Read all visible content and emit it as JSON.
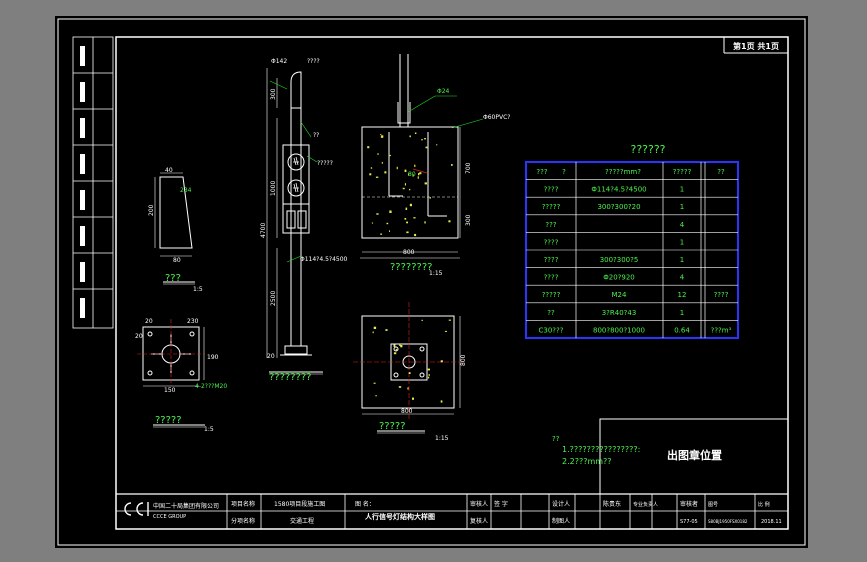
{
  "title_block": {
    "page_label": "第1页 共1页",
    "company_cn": "中国二十局集团有限公司",
    "company_en": "CCCE GROUP",
    "project_name_label": "项目名称",
    "project_name_value": "1580项目段施工图",
    "drawing_label": "图 名：",
    "drawing_value": "人行信号灯结构大样图",
    "sub_project_label": "分项名称",
    "sub_project_value": "交通工程",
    "reviewer_label": "审核人",
    "reviewer_value": "签 字",
    "checker_label": "复核人",
    "designer_label": "设计人",
    "designer_value": "陈贵东",
    "cad_label": "制图人",
    "spec_label": "专业负责人",
    "review_label": "审核者",
    "dwg_no_label": "图号",
    "dwg_no_value": "S80BJ1950FSX0182",
    "sheet_label": "比 例",
    "sheet_value": "S77-05",
    "date_value": "2018.11"
  },
  "stamp_label": "出图章位置",
  "notes": {
    "label": "??",
    "lines": [
      "1.????????????????:",
      "2.2???mm??"
    ]
  },
  "table": {
    "title": "??????",
    "headers": [
      "???",
      "?",
      "?????mm?",
      "?????",
      "??"
    ],
    "rows": [
      {
        "name": "????",
        "spec": "Φ114?4.5?4500",
        "qty": "1",
        "unit": ""
      },
      {
        "name": "?????",
        "spec": "300?300?20",
        "qty": "1",
        "unit": ""
      },
      {
        "name": "???",
        "spec": "",
        "qty": "4",
        "unit": ""
      },
      {
        "name": "????",
        "spec": "",
        "qty": "1",
        "unit": ""
      },
      {
        "name": "????",
        "spec": "300?300?5",
        "qty": "1",
        "unit": ""
      },
      {
        "name": "????",
        "spec": "Φ20?920",
        "qty": "4",
        "unit": ""
      },
      {
        "name": "?????",
        "spec": "M24",
        "qty": "12",
        "unit": "????"
      },
      {
        "name": "??",
        "spec": "3?R40?43",
        "qty": "1",
        "unit": ""
      },
      {
        "name": "C30???",
        "spec": "800?800?1000",
        "qty": "0.64",
        "unit": "???m³"
      }
    ]
  },
  "views": {
    "stiffener": {
      "caption": "???",
      "scale": "1:5",
      "dims": [
        "40",
        "234",
        "200",
        "80"
      ]
    },
    "baseplate": {
      "caption": "?????",
      "scale": "1:5",
      "dims": [
        "20",
        "230",
        "20",
        "150",
        "190",
        "4-2???M20"
      ]
    },
    "pole": {
      "caption": "????????",
      "dims": [
        "Φ142",
        "????",
        "300",
        "??",
        "?????",
        "1000",
        "4700",
        "2500",
        "Φ114?4.5?4500",
        "20"
      ]
    },
    "foundation_section": {
      "caption": "????????",
      "scale": "1:15",
      "dims": [
        "Φ24",
        "Φ60PVC?",
        "700",
        "300",
        "800",
        "80"
      ]
    },
    "foundation_plan": {
      "caption": "?????",
      "scale": "1:15",
      "dims": [
        "800",
        "800"
      ]
    }
  },
  "colors": {
    "background": "#7f7f7f",
    "paper": "#000000",
    "line": "#ffffff",
    "text_green": "#4cf24c",
    "table_border": "#2a34ff",
    "leader": "#1fe01f",
    "concrete_dots": "#e8e84a"
  }
}
